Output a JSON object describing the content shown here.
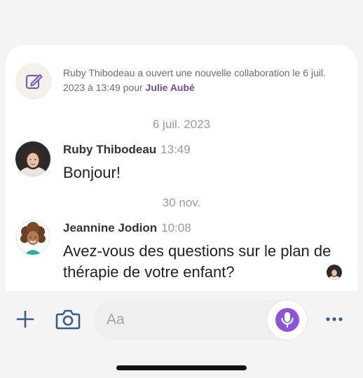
{
  "conversation": {
    "system_message": {
      "icon": "edit-icon",
      "text": "Ruby Thibodeau a ouvert une nouvelle collaboration le 6 juil. 2023 à 13:49 pour ",
      "highlight_name": "Julie Aubé"
    },
    "date_separators": [
      "6 juil. 2023",
      "30 nov."
    ],
    "messages": [
      {
        "author": "Ruby Thibodeau",
        "time": "13:49",
        "text": "Bonjour!",
        "avatar": "avatar-ruby"
      },
      {
        "author": "Jeannine Jodion",
        "time": "10:08",
        "text": "Avez-vous des questions sur le plan de thérapie de votre enfant?",
        "avatar": "avatar-jeannine",
        "read_receipt_avatar": "avatar-ruby"
      }
    ]
  },
  "composer": {
    "add_icon": "plus-icon",
    "camera_icon": "camera-icon",
    "placeholder": "Aa",
    "mic_icon": "microphone-icon",
    "more_icon": "more-horizontal-icon"
  },
  "colors": {
    "accent": "#8a55d8",
    "name_highlight": "#6b4fa0",
    "icon_blue": "#3a5a8c",
    "background": "#f4f4f4"
  }
}
